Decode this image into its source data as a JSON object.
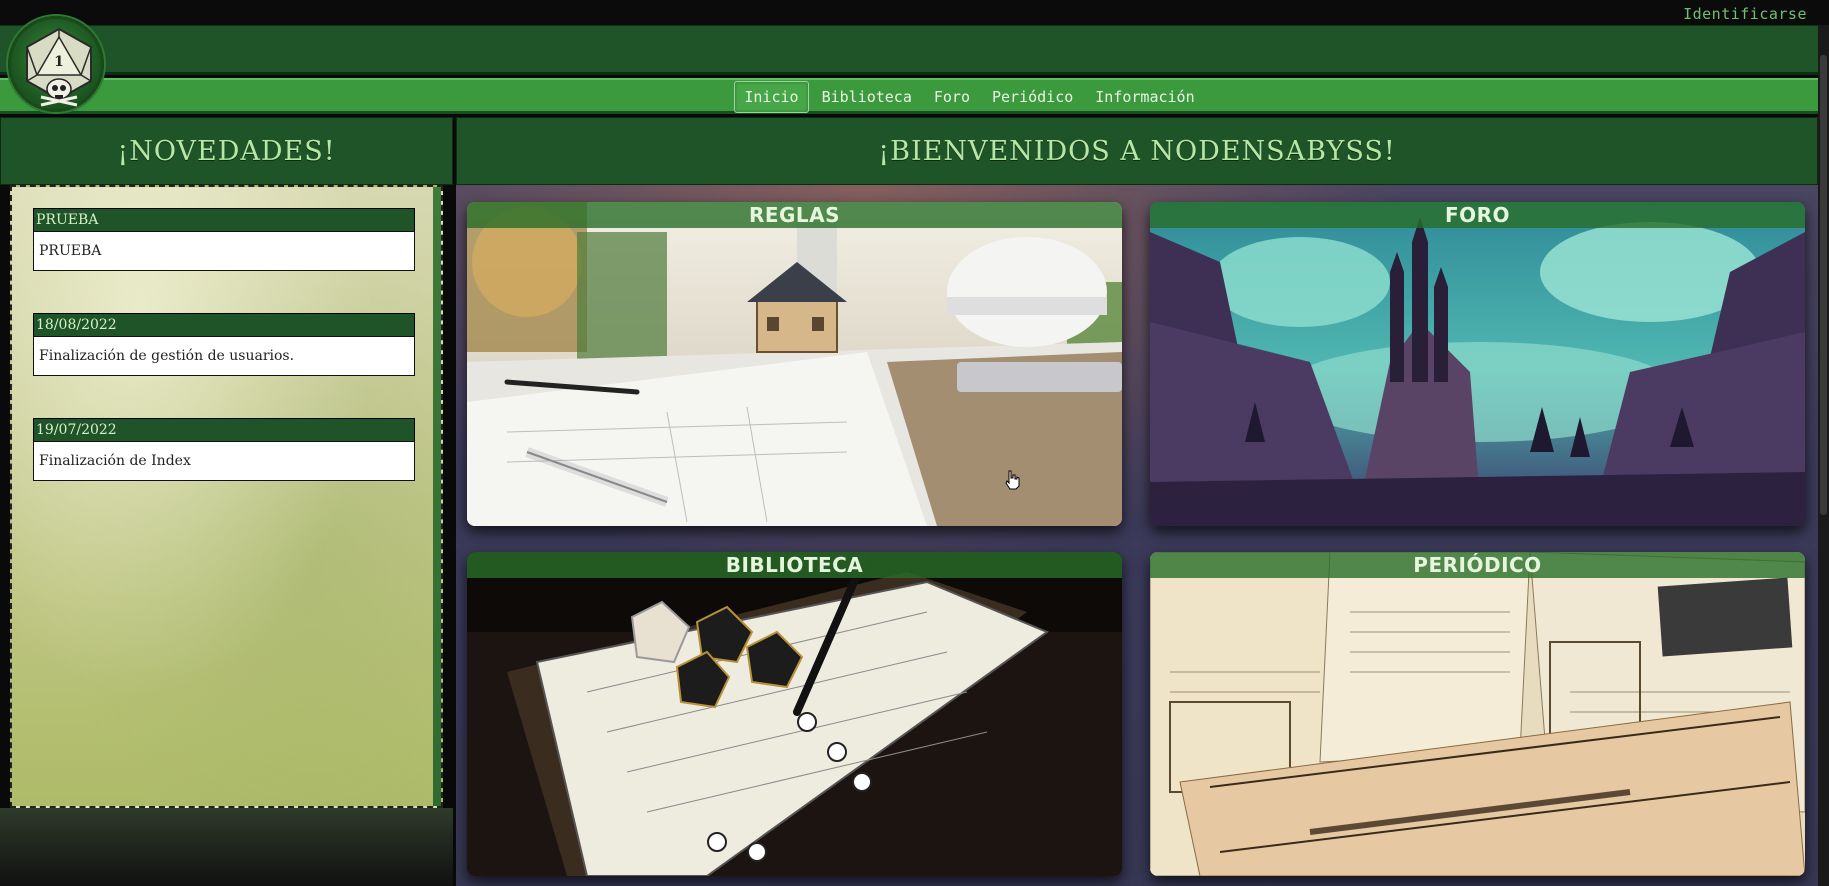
{
  "header": {
    "login_label": "Identificarse",
    "logo_number": "1"
  },
  "nav": {
    "items": [
      {
        "label": "Inicio",
        "active": true
      },
      {
        "label": "Biblioteca",
        "active": false
      },
      {
        "label": "Foro",
        "active": false
      },
      {
        "label": "Periódico",
        "active": false
      },
      {
        "label": "Información",
        "active": false
      }
    ]
  },
  "sidebar": {
    "title": "¡NOVEDADES!",
    "news": [
      {
        "date": "PRUEBA",
        "text": "PRUEBA"
      },
      {
        "date": "18/08/2022",
        "text": "Finalización de gestión de usuarios."
      },
      {
        "date": "19/07/2022",
        "text": "Finalización de Index"
      }
    ]
  },
  "main": {
    "title": "¡BIENVENIDOS A NODENSABYSS!",
    "cards": [
      {
        "title": "REGLAS"
      },
      {
        "title": "FORO"
      },
      {
        "title": "BIBLIOTECA"
      },
      {
        "title": "PERIÓDICO"
      }
    ]
  },
  "colors": {
    "header_green": "#1e5428",
    "nav_green": "#3c9a3e",
    "accent_text": "#b8e6a6"
  }
}
